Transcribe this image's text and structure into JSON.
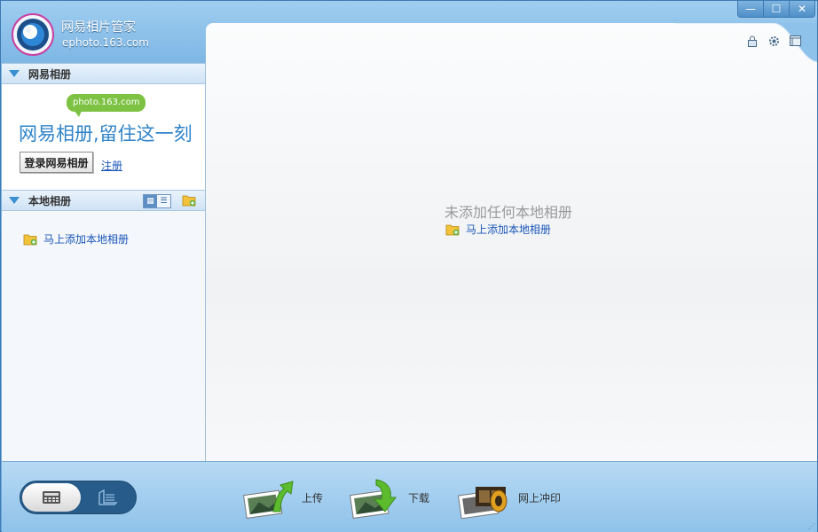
{
  "app": {
    "name": "网易相片管家",
    "domain": "ephoto.163.com"
  },
  "window_controls": {
    "minimize": "—",
    "maximize": "☐",
    "close": "✕"
  },
  "netease_section": {
    "header": "网易相册",
    "bubble": "photo.163.com",
    "slogan": "网易相册,留住这一刻",
    "login_button": "登录网易相册",
    "register_link": "注册"
  },
  "local_section": {
    "header": "本地相册",
    "add_album_link": "马上添加本地相册"
  },
  "main": {
    "empty_title": "未添加任何本地相册",
    "add_album_link": "马上添加本地相册"
  },
  "bottom_actions": [
    {
      "label": "上传"
    },
    {
      "label": "下载"
    },
    {
      "label": "网上冲印"
    }
  ],
  "colors": {
    "accent": "#2f83c8",
    "link": "#1a56b8",
    "promo_green": "#7dc243"
  }
}
